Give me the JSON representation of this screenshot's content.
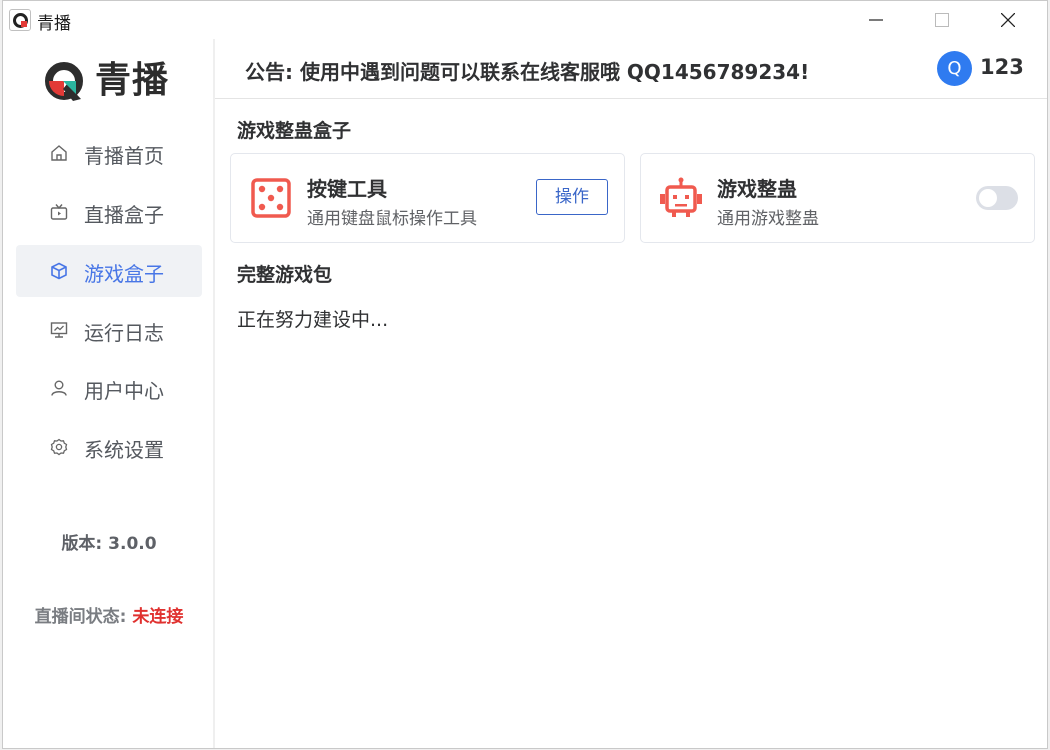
{
  "window": {
    "title": "青播"
  },
  "sidebar": {
    "logo_text": "青播",
    "items": [
      {
        "label": "青播首页",
        "icon": "home-icon",
        "active": false
      },
      {
        "label": "直播盒子",
        "icon": "tv-icon",
        "active": false
      },
      {
        "label": "游戏盒子",
        "icon": "cube-icon",
        "active": true
      },
      {
        "label": "运行日志",
        "icon": "monitor-chart-icon",
        "active": false
      },
      {
        "label": "用户中心",
        "icon": "user-icon",
        "active": false
      },
      {
        "label": "系统设置",
        "icon": "gear-icon",
        "active": false
      }
    ],
    "version_label": "版本: 3.0.0",
    "status_label": "直播间状态: ",
    "status_value": "未连接"
  },
  "header": {
    "notice": "公告: 使用中遇到问题可以联系在线客服哦 QQ1456789234!",
    "avatar_letter": "Q",
    "user_id": "123"
  },
  "main": {
    "section1_title": "游戏整蛊盒子",
    "cards": [
      {
        "title": "按键工具",
        "desc": "通用键盘鼠标操作工具",
        "icon": "dice-icon",
        "action_label": "操作"
      },
      {
        "title": "游戏整蛊",
        "desc": "通用游戏整蛊",
        "icon": "robot-icon",
        "toggle_on": false
      }
    ],
    "section2_title": "完整游戏包",
    "building_text": "正在努力建设中..."
  },
  "colors": {
    "accent": "#4876e6",
    "icon_red": "#f05a4f",
    "status_red": "#e0312f",
    "avatar_blue": "#2f7bf0"
  }
}
